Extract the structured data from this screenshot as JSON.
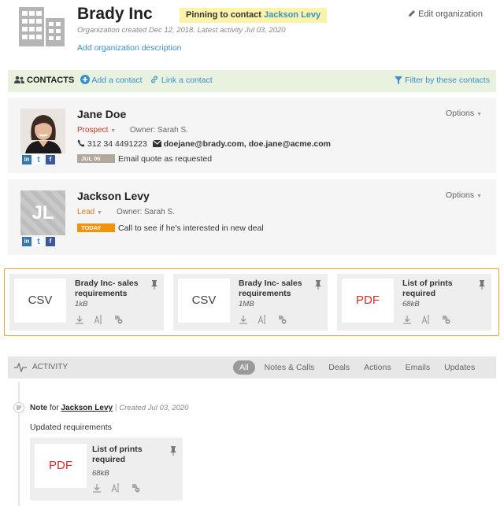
{
  "organization": {
    "name": "Brady Inc",
    "pin_label": "Pinning to contact ",
    "pin_contact": "Jackson Levy",
    "meta": "Organization created Dec 12, 2018. Latest activity Jul 03, 2020",
    "add_description": "Add organization description",
    "edit_label": "Edit organization"
  },
  "contacts_bar": {
    "title": "CONTACTS",
    "add_contact": "Add a contact",
    "link_contact": "Link a contact",
    "filter": "Filter by these contacts"
  },
  "contacts": [
    {
      "name": "Jane Doe",
      "type": "Prospect",
      "owner": "Owner: Sarah S.",
      "phone": "312 34 4491223",
      "emails": "doejane@brady.com, doe.jane@acme.com",
      "task_badge": "JUL 06",
      "task": "Email quote as requested",
      "options": "Options"
    },
    {
      "name": "Jackson Levy",
      "initials": "JL",
      "type": "Lead",
      "owner": "Owner: Sarah S.",
      "task_badge": "TODAY",
      "task": "Call to see if he's interested in new deal",
      "options": "Options"
    }
  ],
  "social_labels": {
    "linkedin": "in",
    "twitter": "t",
    "facebook": "f"
  },
  "pinned_files": [
    {
      "thumb": "CSV",
      "name": "Brady Inc- sales requirements",
      "size": "1kB"
    },
    {
      "thumb": "CSV",
      "name": "Brady Inc- sales requirements",
      "size": "1MB"
    },
    {
      "thumb": "PDF",
      "name": "List of prints required",
      "size": "68kB"
    }
  ],
  "activity": {
    "title": "ACTIVITY",
    "tabs": [
      "All",
      "Notes & Calls",
      "Deals",
      "Actions",
      "Emails",
      "Updates"
    ]
  },
  "note": {
    "kind": "Note",
    "for_word": "for",
    "contact": "Jackson Levy",
    "separator": "|",
    "created": "Created Jul 03, 2020",
    "body": "Updated requirements",
    "file": {
      "thumb": "PDF",
      "name": "List of prints required",
      "size": "68kB"
    }
  },
  "colors": {
    "accent_blue": "#3a8fc9",
    "pin_highlight": "#fbf3a7",
    "contacts_bar": "#e8f2df",
    "pinned_border": "#f0a12d",
    "prospect": "#c0392b",
    "lead": "#e07b20",
    "today_badge": "#f0940f",
    "pdf_red": "#d92a2a"
  }
}
